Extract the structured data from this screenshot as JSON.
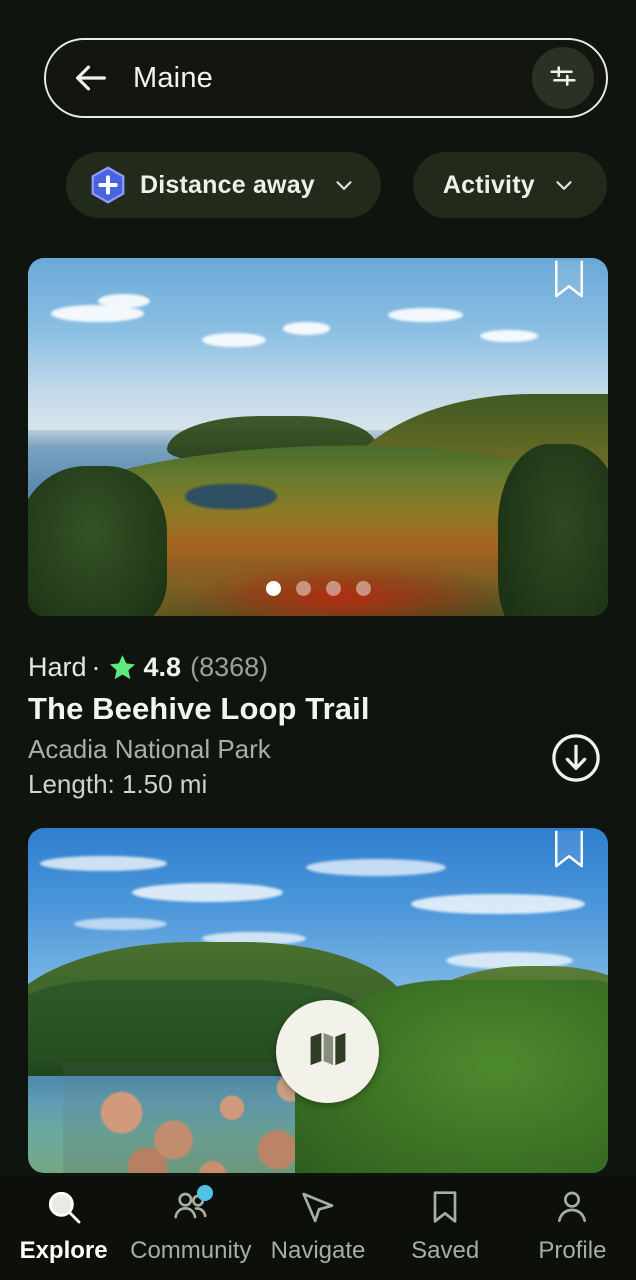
{
  "search": {
    "query": "Maine",
    "back_icon": "back-arrow-icon",
    "filter_icon": "tune-sliders-icon"
  },
  "filters": {
    "chips": [
      {
        "label": "Distance away",
        "badge_icon": "plus-hexagon-icon",
        "chevron_icon": "chevron-down-icon",
        "has_badge": true
      },
      {
        "label": "Activity",
        "chevron_icon": "chevron-down-icon",
        "has_badge": false
      }
    ]
  },
  "results": [
    {
      "photo_alt": "Autumn coastal forest overlook with ocean",
      "bookmark_icon": "bookmark-outline-icon",
      "carousel": {
        "total": 4,
        "active_index": 0
      },
      "difficulty": "Hard",
      "separator": "·",
      "star_icon": "star-icon",
      "rating": "4.8",
      "review_count": "(8368)",
      "name": "The Beehive Loop Trail",
      "park": "Acadia National Park",
      "length": "Length: 1.50 mi",
      "download_icon": "download-circle-icon"
    },
    {
      "photo_alt": "Blue sky over lake with green hills and pink granite boulders",
      "bookmark_icon": "bookmark-outline-icon"
    }
  ],
  "map_fab": {
    "icon": "map-icon",
    "label": "Map"
  },
  "bottom_nav": {
    "items": [
      {
        "label": "Explore",
        "icon": "search-icon",
        "active": true,
        "badge": false
      },
      {
        "label": "Community",
        "icon": "people-icon",
        "active": false,
        "badge": true
      },
      {
        "label": "Navigate",
        "icon": "navigate-icon",
        "active": false,
        "badge": false
      },
      {
        "label": "Saved",
        "icon": "bookmark-icon",
        "active": false,
        "badge": false
      },
      {
        "label": "Profile",
        "icon": "person-icon",
        "active": false,
        "badge": false
      }
    ]
  },
  "colors": {
    "background": "#10140f",
    "chip_bg": "#222a1c",
    "star_green": "#5fe87e",
    "plus_blue": "#4a63e0",
    "badge_blue": "#4fc3e8",
    "text_primary": "#f3f5f0",
    "text_muted": "#a8b0a2"
  }
}
